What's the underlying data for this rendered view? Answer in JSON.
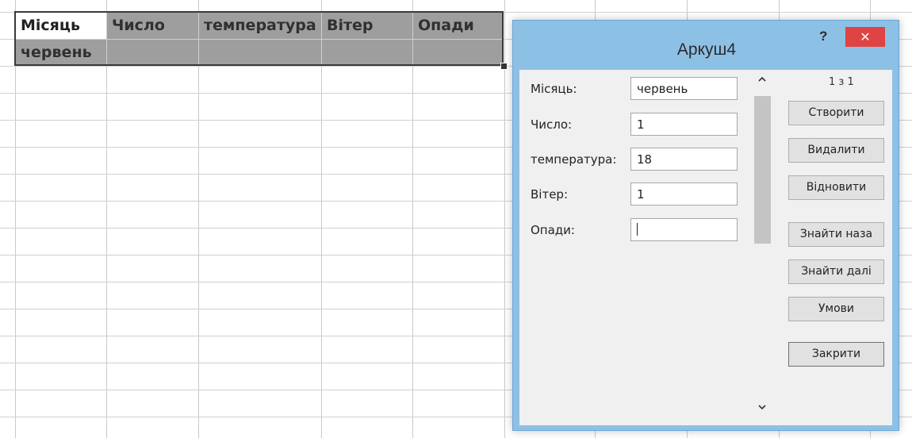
{
  "sheet": {
    "headers": [
      "Місяць",
      "Число",
      "температура",
      "Вітер",
      "Опади"
    ],
    "row1": [
      "червень",
      "",
      "",
      "",
      ""
    ]
  },
  "dialog": {
    "title": "Аркуш4",
    "help_label": "?",
    "close_label": "✕",
    "record_counter": "1 з 1",
    "fields": [
      {
        "label": "Місяць:",
        "value": "червень"
      },
      {
        "label": "Число:",
        "value": "1"
      },
      {
        "label": "температура:",
        "value": "18"
      },
      {
        "label": "Вітер:",
        "value": "1"
      },
      {
        "label": "Опади:",
        "value": ""
      }
    ],
    "buttons": {
      "new": "Створити",
      "delete": "Видалити",
      "restore": "Відновити",
      "find_prev": "Знайти наза",
      "find_next": "Знайти далі",
      "criteria": "Умови",
      "close": "Закрити"
    },
    "scroll_up_icon": "chevron-up-icon",
    "scroll_down_icon": "chevron-down-icon"
  }
}
